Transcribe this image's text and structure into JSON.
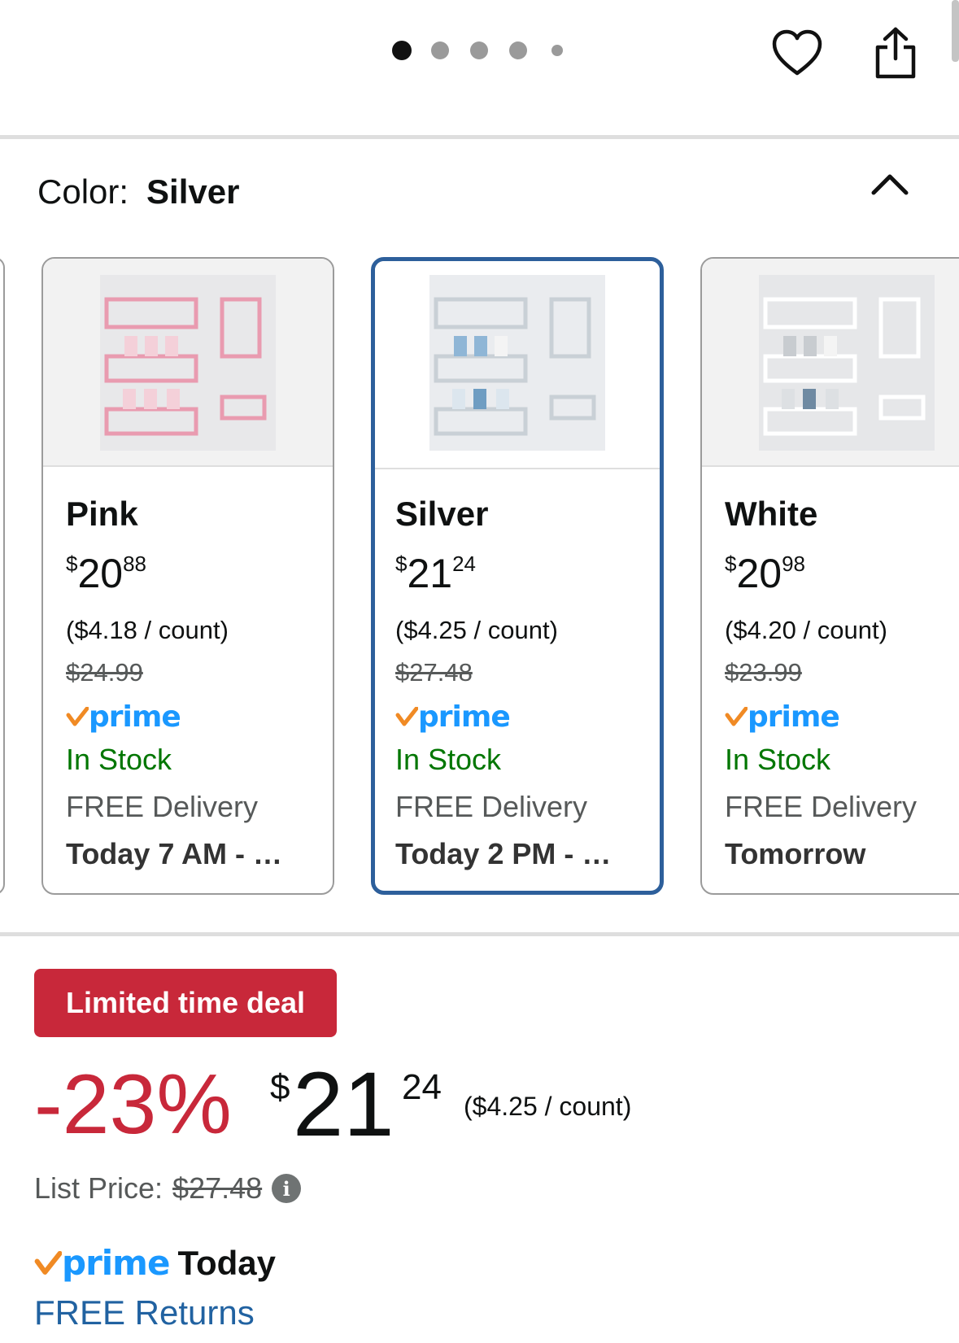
{
  "carousel": {
    "dot_count": 5,
    "active_index": 0
  },
  "color_section": {
    "label": "Color:",
    "selected": "Silver"
  },
  "swatches": [
    {
      "name": "Pink",
      "currency": "$",
      "whole": "20",
      "frac": "88",
      "unit_price": "($4.18 / count)",
      "was": "$24.99",
      "prime": "prime",
      "stock": "In Stock",
      "delivery": "FREE Delivery",
      "when": "Today 7 AM - …",
      "accent": "#e99bb0"
    },
    {
      "name": "Silver",
      "currency": "$",
      "whole": "21",
      "frac": "24",
      "unit_price": "($4.25 / count)",
      "was": "$27.48",
      "prime": "prime",
      "stock": "In Stock",
      "delivery": "FREE Delivery",
      "when": "Today 2 PM - …",
      "accent": "#8fb6d6"
    },
    {
      "name": "White",
      "currency": "$",
      "whole": "20",
      "frac": "98",
      "unit_price": "($4.20 / count)",
      "was": "$23.99",
      "prime": "prime",
      "stock": "In Stock",
      "delivery": "FREE Delivery",
      "when": "Tomorrow",
      "accent": "#c8ccd0"
    }
  ],
  "deal": {
    "badge": "Limited time deal",
    "discount": "-23%",
    "currency": "$",
    "whole": "21",
    "frac": "24",
    "unit_price": "($4.25 / count)",
    "list_label": "List Price:",
    "list_value": "$27.48",
    "prime": "prime",
    "prime_when": "Today",
    "returns": "FREE Returns"
  },
  "colors": {
    "deal_red": "#c8283a",
    "prime_blue": "#1a98ff",
    "stock_green": "#007600",
    "selected_border": "#2d5f9b",
    "link_blue": "#2162a1",
    "prime_check": "#f08a24"
  }
}
